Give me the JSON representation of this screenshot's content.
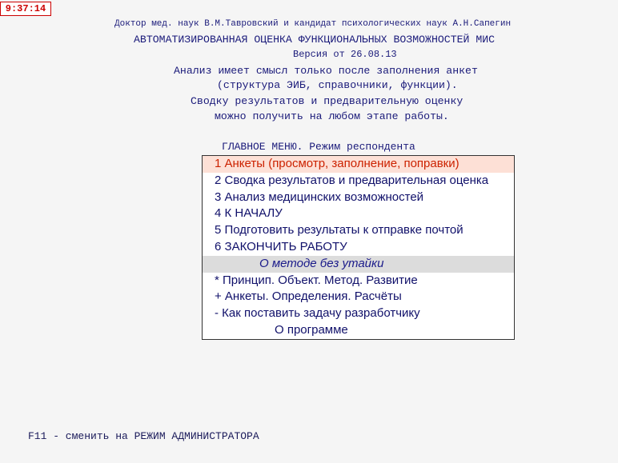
{
  "clock": "9:37:14",
  "header": {
    "authors": "Доктор мед. наук В.М.Тавровский и кандидат психологических наук А.Н.Сапегин",
    "title": "АВТОМАТИЗИРОВАННАЯ ОЦЕНКА ФУНКЦИОНАЛЬНЫХ ВОЗМОЖНОСТЕЙ МИС",
    "version": "Версия от 26.08.13"
  },
  "notes": [
    "Анализ имеет смысл только после заполнения анкет",
    "(структура ЭИБ, справочники, функции).",
    "Сводку результатов и предварительную оценку",
    "можно получить на любом этапе работы."
  ],
  "menu": {
    "heading": "ГЛАВНОЕ МЕНЮ. Режим респондента",
    "items": [
      "1  Анкеты (просмотр, заполнение, поправки)",
      "2  Сводка результатов и предварительная оценка",
      "3  Анализ медицинских возможностей",
      "4  К НАЧАЛУ",
      "5  Подготовить результаты к отправке почтой",
      "6  ЗАКОНЧИТЬ РАБОТУ",
      "О методе без утайки",
      "* Принцип. Объект. Метод. Развитие",
      "+ Анкеты. Определения. Расчёты",
      "- Как поставить задачу разработчику",
      "О программе"
    ]
  },
  "footer": "F11 - сменить на РЕЖИМ АДМИНИСТРАТОРА",
  "colors": {
    "accent": "#cc2200",
    "selected_bg": "#fde0d6",
    "text": "#10106a"
  }
}
